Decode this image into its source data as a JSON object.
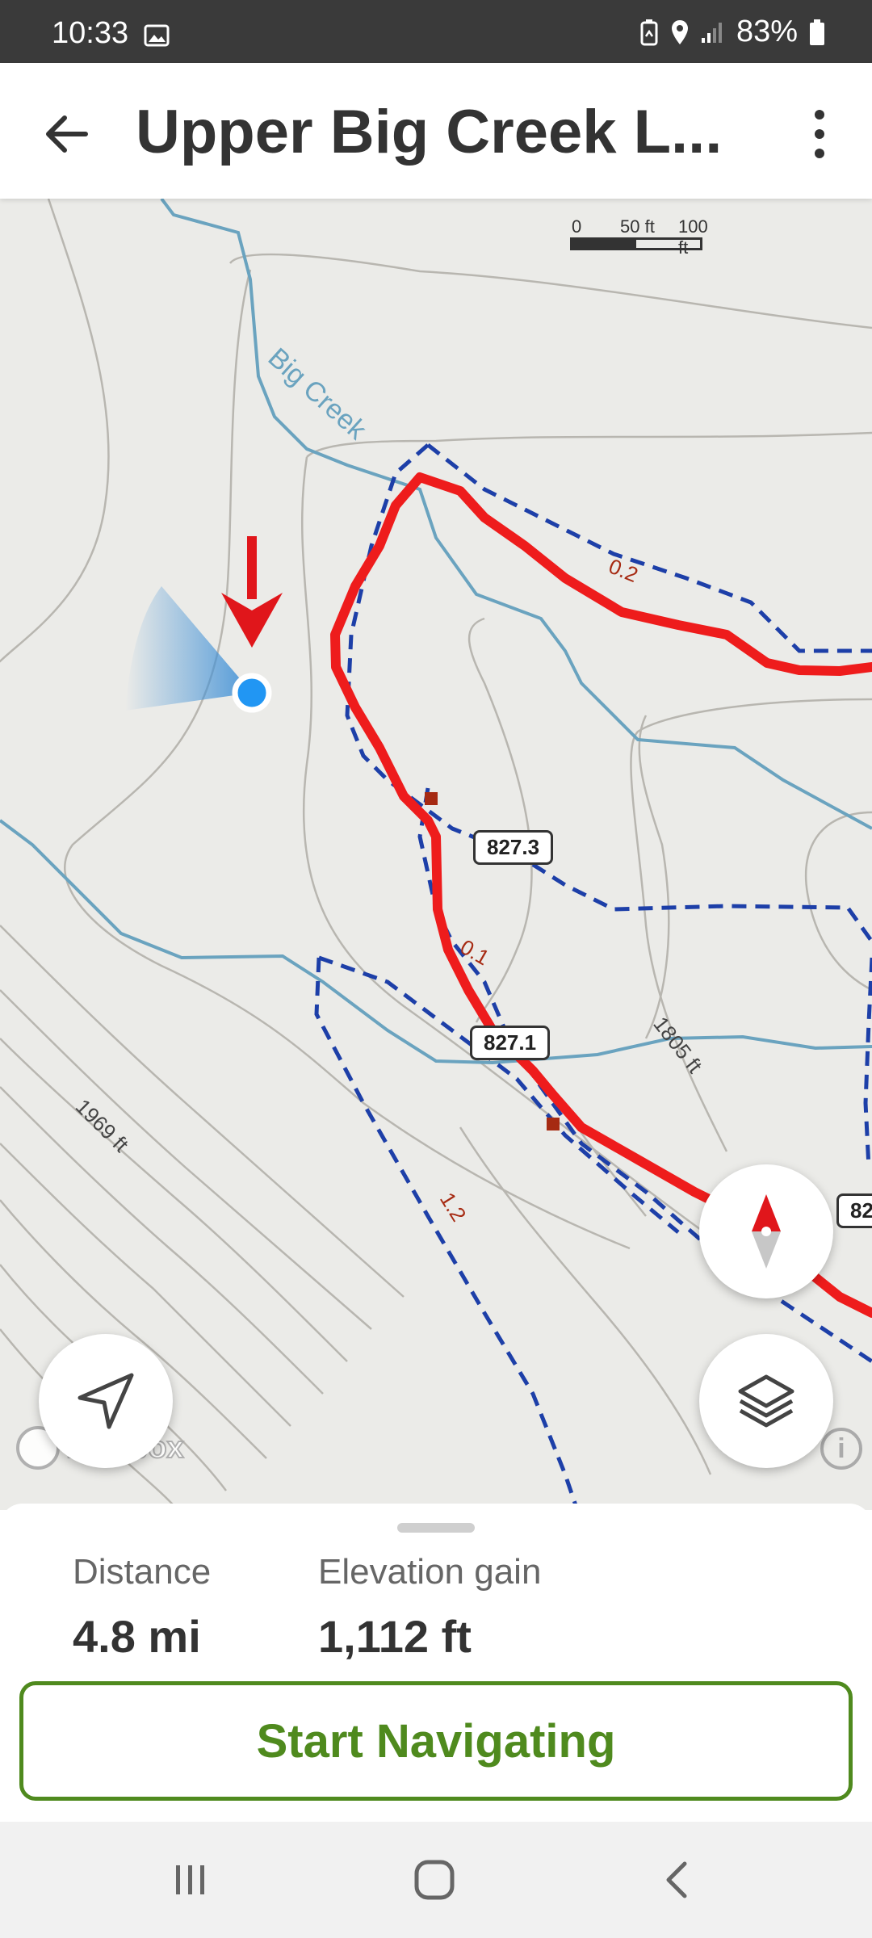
{
  "status_bar": {
    "time": "10:33",
    "battery": "83%",
    "icons": [
      "image-icon",
      "battery-saver-icon",
      "location-icon",
      "signal-icon",
      "battery-icon"
    ]
  },
  "app_bar": {
    "title": "Upper Big Creek L...",
    "back_icon": "arrow-left-icon",
    "more_icon": "more-vertical-icon"
  },
  "map": {
    "scale": {
      "zero": "0",
      "mid": "50 ft",
      "end": "100 ft"
    },
    "creek_label": "Big Creek",
    "trail_labels": [
      "827.3",
      "827.1",
      "82"
    ],
    "distance_markers": [
      "0.2",
      "0.1",
      "1.2"
    ],
    "elevation_labels": [
      "1969 ft",
      "1805 ft"
    ],
    "attribution": "mapbox",
    "colors": {
      "route": "#ee1c1c",
      "trail_dashed": "#1d3fa8",
      "creek": "#6aa3bf",
      "contour": "#b5b3ad",
      "user_location": "#2196f3",
      "annotation_arrow": "#e0161b"
    }
  },
  "controls": {
    "compass": "compass-icon",
    "my_location": "navigation-arrow-icon",
    "layers": "layers-icon"
  },
  "sheet": {
    "distance_label": "Distance",
    "distance_value": "4.8 mi",
    "elevation_label": "Elevation gain",
    "elevation_value": "1,112 ft"
  },
  "action": {
    "start_label": "Start Navigating",
    "accent": "#4f8a1e"
  },
  "system_nav": [
    "recents-icon",
    "home-icon",
    "back-icon"
  ]
}
